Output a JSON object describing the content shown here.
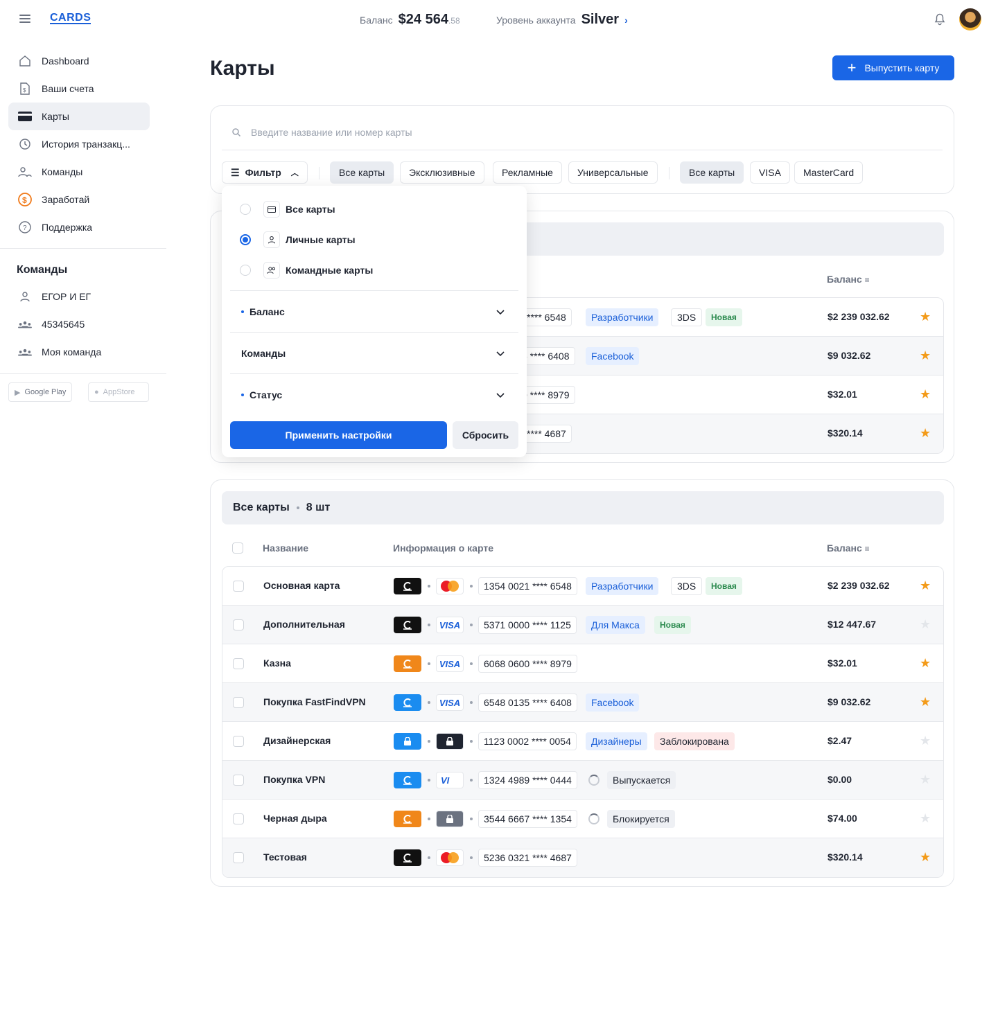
{
  "header": {
    "logo": "CARDS",
    "balance_label": "Баланс",
    "balance_value": "$24 564",
    "balance_cents": ".58",
    "level_label": "Уровень аккаунта",
    "level_value": "Silver"
  },
  "sidebar": {
    "items": [
      {
        "label": "Dashboard",
        "icon": "home-icon"
      },
      {
        "label": "Ваши счета",
        "icon": "document-icon"
      },
      {
        "label": "Карты",
        "icon": "card-icon",
        "active": true
      },
      {
        "label": "История транзакц...",
        "icon": "history-icon"
      },
      {
        "label": "Команды",
        "icon": "team-icon"
      },
      {
        "label": "Заработай",
        "icon": "dollar-icon"
      },
      {
        "label": "Поддержка",
        "icon": "help-icon"
      }
    ],
    "teams_title": "Команды",
    "teams": [
      {
        "label": "ЕГОР И ЕГ",
        "icon": "user-icon"
      },
      {
        "label": "45345645",
        "icon": "group-icon"
      },
      {
        "label": "Моя команда",
        "icon": "group-icon"
      }
    ],
    "google_play": "Google Play",
    "app_store": "AppStore"
  },
  "page": {
    "title": "Карты",
    "issue_button": "Выпустить карту"
  },
  "search": {
    "placeholder": "Введите название или номер карты"
  },
  "filter": {
    "label": "Фильтр",
    "type_chips": [
      "Все карты",
      "Эксклюзивные",
      "Рекламные",
      "Универсальные"
    ],
    "network_chips": [
      "Все карты",
      "VISA",
      "MasterCard"
    ]
  },
  "dropdown": {
    "options": [
      "Все карты",
      "Личные карты",
      "Командные карты"
    ],
    "selected_option": "Личные карты",
    "sections": [
      "Баланс",
      "Команды",
      "Статус"
    ],
    "apply": "Применить настройки",
    "reset": "Сбросить"
  },
  "favorites": {
    "balance_header": "Баланс",
    "rows": [
      {
        "num_tail": "l **** 6548",
        "tags": [
          "Разработчики",
          "3DS",
          "Новая"
        ],
        "balance": "$2 239 032.62",
        "fav": true
      },
      {
        "num_tail": "5 **** 6408",
        "tags": [
          "Facebook"
        ],
        "balance": "$9 032.62",
        "fav": true
      },
      {
        "num_tail": "0 **** 8979",
        "tags": [],
        "balance": "$32.01",
        "fav": true
      },
      {
        "num_tail": "l **** 4687",
        "tags": [],
        "balance": "$320.14",
        "fav": true
      }
    ]
  },
  "all_cards": {
    "title": "Все карты",
    "count": "8 шт",
    "col_name": "Название",
    "col_info": "Информация о карте",
    "col_balance": "Баланс",
    "rows": [
      {
        "name": "Основная карта",
        "color": "#111111",
        "net": "mastercard",
        "number": "1354 0021 **** 6548",
        "tags": [
          {
            "t": "Разработчики",
            "k": "blue"
          },
          {
            "t": "3DS",
            "k": "plain"
          },
          {
            "t": "Новая",
            "k": "new"
          }
        ],
        "balance": "$2 239 032.62",
        "fav": true
      },
      {
        "name": "Дополнительная",
        "color": "#111111",
        "net": "visa",
        "number": "5371 0000 **** 1125",
        "tags": [
          {
            "t": "Для Макса",
            "k": "blue"
          },
          {
            "t": "Новая",
            "k": "new"
          }
        ],
        "balance": "$12 447.67",
        "fav": false
      },
      {
        "name": "Казна",
        "color": "#f0871a",
        "net": "visa",
        "number": "6068 0600 **** 8979",
        "tags": [],
        "balance": "$32.01",
        "fav": true
      },
      {
        "name": "Покупка FastFindVPN",
        "color": "#1a8cf0",
        "net": "visa",
        "number": "6548 0135 **** 6408",
        "tags": [
          {
            "t": "Facebook",
            "k": "blue"
          }
        ],
        "balance": "$9 032.62",
        "fav": true
      },
      {
        "name": "Дизайнерская",
        "color": "#1a8cf0",
        "net": "locked",
        "number": "1123 0002 **** 0054",
        "tags": [
          {
            "t": "Дизайнеры",
            "k": "blue"
          },
          {
            "t": "Заблокирована",
            "k": "red"
          }
        ],
        "balance": "$2.47",
        "fav": false,
        "locked": true
      },
      {
        "name": "Покупка VPN",
        "color": "#1a8cf0",
        "net": "visa-partial",
        "number": "1324 4989 **** 0444",
        "tags": [
          {
            "t": "Выпускается",
            "k": "gray"
          }
        ],
        "spinner": true,
        "balance": "$0.00",
        "fav": false
      },
      {
        "name": "Черная дыра",
        "color": "#f0871a",
        "net": "locked-gray",
        "number": "3544 6667 **** 1354",
        "tags": [
          {
            "t": "Блокируется",
            "k": "gray"
          }
        ],
        "spinner": true,
        "balance": "$74.00",
        "fav": false
      },
      {
        "name": "Тестовая",
        "color": "#111111",
        "net": "mastercard",
        "number": "5236 0321 **** 4687",
        "tags": [],
        "balance": "$320.14",
        "fav": true
      }
    ]
  }
}
